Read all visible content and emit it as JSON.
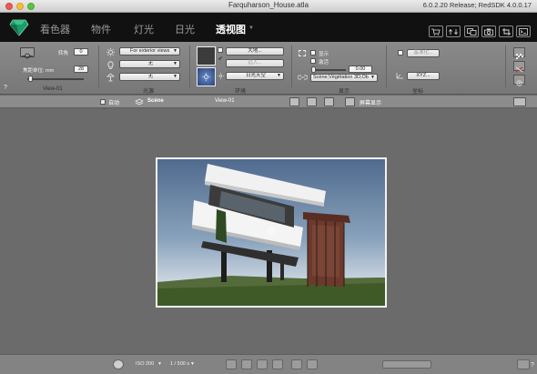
{
  "window": {
    "title": "Farquharson_House.atla",
    "version": "6.0.2.20 Release; RedSDK 4.0.0.17"
  },
  "tabs": [
    {
      "label": "看色器",
      "active": false
    },
    {
      "label": "物件",
      "active": false
    },
    {
      "label": "灯光",
      "active": false
    },
    {
      "label": "日光",
      "active": false
    },
    {
      "label": "透视图",
      "active": true
    }
  ],
  "camera": {
    "rotation_label": "转角",
    "rotation_value": "0",
    "focal_label": "焦距单位: mm",
    "focal_value": "28",
    "view_name": "View-01",
    "help": "?"
  },
  "lighting": {
    "exterior_option": "For exterior views",
    "option2": "无",
    "option3": "无",
    "section_label": "光源"
  },
  "environment": {
    "atmosphere_button": "大地...",
    "import_button": "远入...",
    "sky_option": "日光天空",
    "section_label": "环境"
  },
  "display": {
    "show_label": "显示",
    "activate_label": "激活",
    "value": "0.00",
    "scene_option": "Scène;Végétation 3D;Ob",
    "section_label": "显示"
  },
  "coords": {
    "relative_button": "基准化...",
    "xyz_button": "XYZ...",
    "section_label": "坐标"
  },
  "viewbar": {
    "auto_label": "自动",
    "scene_label": "Scène",
    "view_label": "View-01",
    "screen_label": "屏幕显示"
  },
  "bottombar": {
    "iso": "ISO 200",
    "shutter": "1 / 500 s",
    "help": "?"
  },
  "colors": {
    "tabbar": "#111111",
    "panel": "#808080",
    "canvas": "#6b6b6b",
    "sky_top": "#4f6a8e",
    "sky_bottom": "#cfd9e2",
    "grass": "#3f5a26"
  }
}
